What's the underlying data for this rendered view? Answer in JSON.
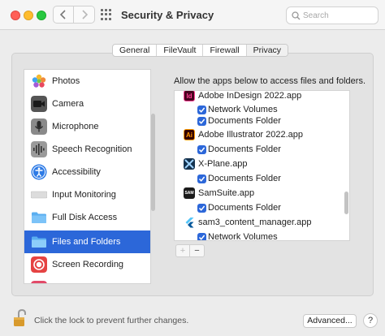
{
  "window": {
    "title": "Security & Privacy",
    "search_placeholder": "Search"
  },
  "tabs": [
    {
      "label": "General",
      "active": false
    },
    {
      "label": "FileVault",
      "active": false
    },
    {
      "label": "Firewall",
      "active": false
    },
    {
      "label": "Privacy",
      "active": true
    }
  ],
  "sidebar": {
    "items": [
      {
        "label": "Photos",
        "icon": "photos-icon"
      },
      {
        "label": "Camera",
        "icon": "camera-icon"
      },
      {
        "label": "Microphone",
        "icon": "microphone-icon"
      },
      {
        "label": "Speech Recognition",
        "icon": "speech-recognition-icon"
      },
      {
        "label": "Accessibility",
        "icon": "accessibility-icon"
      },
      {
        "label": "Input Monitoring",
        "icon": "keyboard-icon"
      },
      {
        "label": "Full Disk Access",
        "icon": "folder-icon"
      },
      {
        "label": "Files and Folders",
        "icon": "folder-icon",
        "selected": true
      },
      {
        "label": "Screen Recording",
        "icon": "screen-recording-icon"
      }
    ]
  },
  "panel": {
    "description": "Allow the apps below to access files and folders.",
    "apps": [
      {
        "name": "Adobe InDesign 2022.app",
        "icon_text": "Id",
        "permissions": [
          "Network Volumes",
          "Documents Folder"
        ]
      },
      {
        "name": "Adobe Illustrator 2022.app",
        "icon_text": "Ai",
        "permissions": [
          "Documents Folder"
        ]
      },
      {
        "name": "X-Plane.app",
        "icon_text": "",
        "permissions": [
          "Documents Folder"
        ]
      },
      {
        "name": "SamSuite.app",
        "icon_text": "SAM",
        "permissions": [
          "Documents Folder"
        ]
      },
      {
        "name": "sam3_content_manager.app",
        "icon_text": "",
        "permissions": [
          "Network Volumes"
        ]
      }
    ],
    "add_label": "+",
    "remove_label": "−"
  },
  "footer": {
    "lock_text": "Click the lock to prevent further changes.",
    "advanced_label": "Advanced...",
    "help_label": "?"
  },
  "colors": {
    "accent": "#2c67d9",
    "indesign": "#49021f",
    "illustrator": "#330000"
  }
}
